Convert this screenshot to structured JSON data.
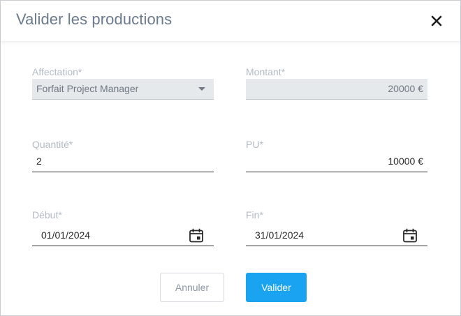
{
  "dialog": {
    "title": "Valider les productions",
    "close_icon": "close-icon"
  },
  "form": {
    "affectation": {
      "label": "Affectation*",
      "value": "Forfait Project Manager"
    },
    "montant": {
      "label": "Montant*",
      "value": "20000 €"
    },
    "quantite": {
      "label": "Quantité*",
      "value": "2"
    },
    "pu": {
      "label": "PU*",
      "value": "10000 €"
    },
    "debut": {
      "label": "Début*",
      "value": "01/01/2024"
    },
    "fin": {
      "label": "Fin*",
      "value": "31/01/2024"
    }
  },
  "actions": {
    "cancel_label": "Annuler",
    "confirm_label": "Valider"
  },
  "colors": {
    "title": "#6b7a8c",
    "label": "#b3bac3",
    "readonly_bg": "#e6e9ec",
    "primary": "#1aa3f0"
  }
}
